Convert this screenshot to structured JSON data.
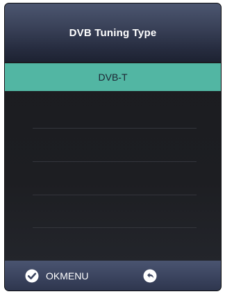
{
  "header": {
    "title": "DVB Tuning Type"
  },
  "options": {
    "selected_label": "DVB-T"
  },
  "footer": {
    "ok_icon": "check-circle-icon",
    "ok_label": "OKMENU",
    "back_icon": "return-arrow-icon"
  },
  "colors": {
    "highlight": "#52b6a3",
    "header": "#3a4259",
    "background": "#1a1b1f",
    "footer": "#3c4560"
  }
}
